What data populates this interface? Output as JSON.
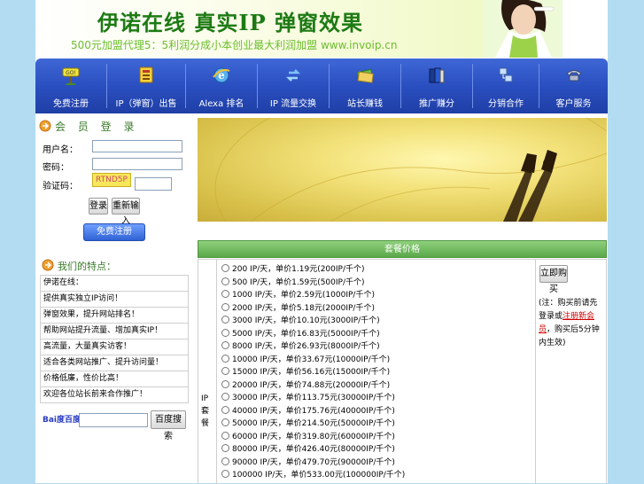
{
  "banner": {
    "title": "伊诺在线 真实IP 弹窗效果",
    "slogan": "500元加盟代理5：5利润分成小本创业最大利润加盟 www.invoip.cn"
  },
  "nav": {
    "items": [
      {
        "label": "免费注册",
        "icon": "go-sign-icon"
      },
      {
        "label": "IP（弹窗）出售",
        "icon": "billboard-icon"
      },
      {
        "label": "Alexa 排名",
        "icon": "ie-globe-icon"
      },
      {
        "label": "IP 流量交换",
        "icon": "exchange-icon"
      },
      {
        "label": "站长赚钱",
        "icon": "money-icon"
      },
      {
        "label": "推广赚分",
        "icon": "books-icon"
      },
      {
        "label": "分销合作",
        "icon": "network-icon"
      },
      {
        "label": "客户服务",
        "icon": "phone-icon"
      }
    ]
  },
  "login": {
    "heading": "会 员 登 录",
    "username_label": "用户名：",
    "password_label": "密码：",
    "captcha_label": "验证码：",
    "captcha_text": "RTND5P",
    "login_button": "登录",
    "reset_button": "重新输入",
    "register_button": "免费注册"
  },
  "features": {
    "heading": "我们的特点：",
    "items": [
      "伊诺在线：",
      "提供真实独立IP访问！",
      "弹窗效果，提升网站排名！",
      "帮助网站提升流量、增加真实IP！",
      "高流量，大量真实访客！",
      "适合各类网站推广、提升访问量！",
      "价格低廉，性价比高！",
      "欢迎各位站长前来合作推广！"
    ],
    "search_button": "百度搜索",
    "search_logo": "Bai度百度"
  },
  "panel": {
    "title": "套餐价格",
    "col_label": "IP 套餐",
    "options": [
      "200 IP/天，单价1.19元(200IP/千个)",
      "500 IP/天，单价1.59元(500IP/千个)",
      "1000 IP/天，单价2.59元(1000IP/千个)",
      "2000 IP/天，单价5.18元(2000IP/千个)",
      "3000 IP/天，单价10.10元(3000IP/千个)",
      "5000 IP/天，单价16.83元(5000IP/千个)",
      "8000 IP/天，单价26.93元(8000IP/千个)",
      "10000 IP/天，单价33.67元(10000IP/千个)",
      "15000 IP/天，单价56.16元(15000IP/千个)",
      "20000 IP/天，单价74.88元(20000IP/千个)",
      "30000 IP/天，单价113.75元(30000IP/千个)",
      "40000 IP/天，单价175.76元(40000IP/千个)",
      "50000 IP/天，单价214.50元(50000IP/千个)",
      "60000 IP/天，单价319.80元(60000IP/千个)",
      "80000 IP/天，单价426.40元(80000IP/千个)",
      "90000 IP/天，单价479.70元(90000IP/千个)",
      "100000 IP/天，单价533.00元(100000IP/千个)"
    ],
    "buy_button": "立即购买",
    "note_prefix": "(注：购买前请先登录或",
    "note_link": "注册新会员",
    "note_suffix": "，购买后5分钟内生效)"
  }
}
